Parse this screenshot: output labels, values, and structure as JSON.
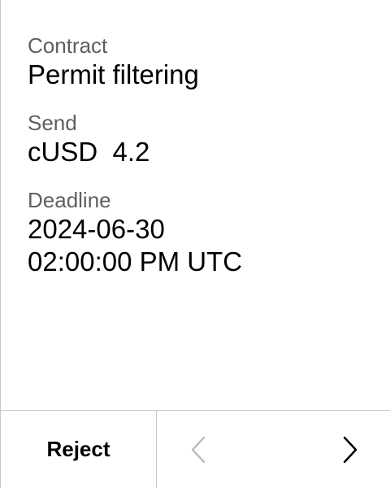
{
  "review": {
    "fields": [
      {
        "label": "Contract",
        "value": "Permit filtering"
      },
      {
        "label": "Send",
        "value": "cUSD  4.2"
      },
      {
        "label": "Deadline",
        "value_lines": [
          "2024-06-30",
          "02:00:00 PM UTC"
        ]
      }
    ]
  },
  "footer": {
    "reject_label": "Reject",
    "prev_icon": "chevron-left-icon",
    "next_icon": "chevron-right-icon",
    "prev_enabled": false,
    "next_enabled": true,
    "colors": {
      "enabled": "#000000",
      "disabled": "#bdbdbd"
    }
  }
}
